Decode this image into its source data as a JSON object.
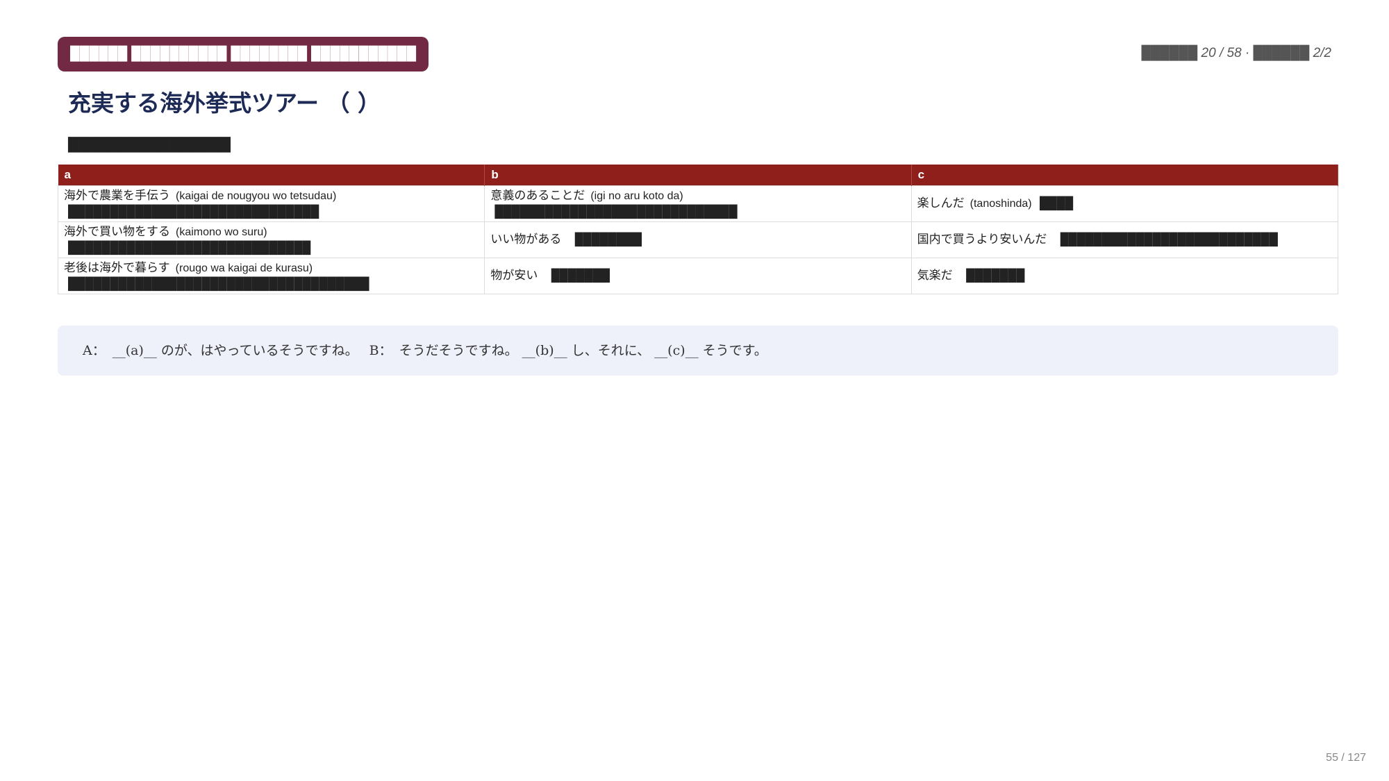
{
  "header": {
    "badge": "██████ ██████████ ████████ ███████████",
    "counter": "██████ 20 / 58 · ██████ 2/2"
  },
  "title": "充実する海外挙式ツアー （ ）",
  "subtitle": "████████████████",
  "table": {
    "columns": [
      "a",
      "b",
      "c"
    ],
    "rows": [
      [
        {
          "jp": "海外で農業を手伝う",
          "rom": "(kaigai de nougyou wo tetsudau)",
          "gloss": "██████████████████████████████"
        },
        {
          "jp": "意義のあることだ",
          "rom": "(igi no aru koto da)",
          "gloss": "█████████████████████████████"
        },
        {
          "jp": "楽しんだ",
          "rom": "(tanoshinda)",
          "gloss": "████"
        }
      ],
      [
        {
          "jp": "海外で買い物をする",
          "rom": "(kaimono wo suru)",
          "gloss": "█████████████████████████████"
        },
        {
          "jp": "いい物がある",
          "rom": "",
          "gloss": "████████"
        },
        {
          "jp": "国内で買うより安いんだ",
          "rom": "",
          "gloss": "██████████████████████████"
        }
      ],
      [
        {
          "jp": "老後は海外で暮らす",
          "rom": "(rougo wa kaigai de kurasu)",
          "gloss": "████████████████████████████████████"
        },
        {
          "jp": "物が安い",
          "rom": "",
          "gloss": "███████"
        },
        {
          "jp": "気楽だ",
          "rom": "",
          "gloss": "███████"
        }
      ]
    ]
  },
  "dialogue": {
    "a_label": "A：",
    "a_text": "__(a)__ のが、はやっているそうですね。",
    "b_label": "B：",
    "b_text": "そうだそうですね。 __(b)__ し、それに、 __(c)__ そうです。"
  },
  "page_number": "55 / 127"
}
